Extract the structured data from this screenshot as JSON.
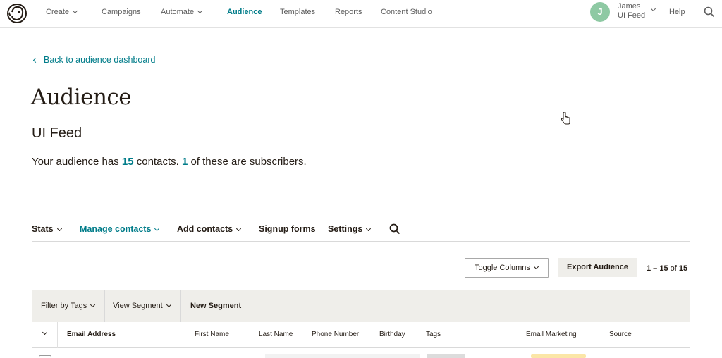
{
  "topnav": {
    "items": [
      {
        "label": "Create",
        "caret": true
      },
      {
        "label": "Campaigns"
      },
      {
        "label": "Automate",
        "caret": true
      },
      {
        "label": "Audience",
        "active": true
      },
      {
        "label": "Templates"
      },
      {
        "label": "Reports"
      },
      {
        "label": "Content Studio"
      }
    ],
    "avatar_initial": "J",
    "account_name": "James",
    "account_sub": "UI Feed",
    "help_label": "Help",
    "icons": {
      "logo": "freddie-logo-icon",
      "search": "search-icon"
    }
  },
  "back_link": "Back to audience dashboard",
  "page_title": "Audience",
  "audience_name": "UI Feed",
  "summary": {
    "part1": "Your audience has ",
    "contacts": "15",
    "part2": " contacts. ",
    "subscribers": "1",
    "part3": " of these are subscribers."
  },
  "subnav": {
    "items": [
      {
        "label": "Stats",
        "caret": true
      },
      {
        "label": "Manage contacts",
        "caret": true,
        "active": true
      },
      {
        "label": "Add contacts",
        "caret": true
      },
      {
        "label": "Signup forms"
      },
      {
        "label": "Settings",
        "caret": true
      }
    ]
  },
  "toolbar": {
    "toggle_columns": "Toggle Columns",
    "export": "Export Audience",
    "range": "1 – 15",
    "of_label": " of ",
    "total": "15"
  },
  "filterbar": {
    "filter_tags": "Filter by Tags",
    "view_segment": "View Segment",
    "new_segment": "New Segment"
  },
  "table": {
    "columns": [
      "Email Address",
      "First Name",
      "Last Name",
      "Phone Number",
      "Birthday",
      "Tags",
      "Email Marketing",
      "Source"
    ]
  },
  "colors": {
    "accent": "#007c89",
    "avatar": "#8ec9a3",
    "panel": "#efeeea"
  }
}
